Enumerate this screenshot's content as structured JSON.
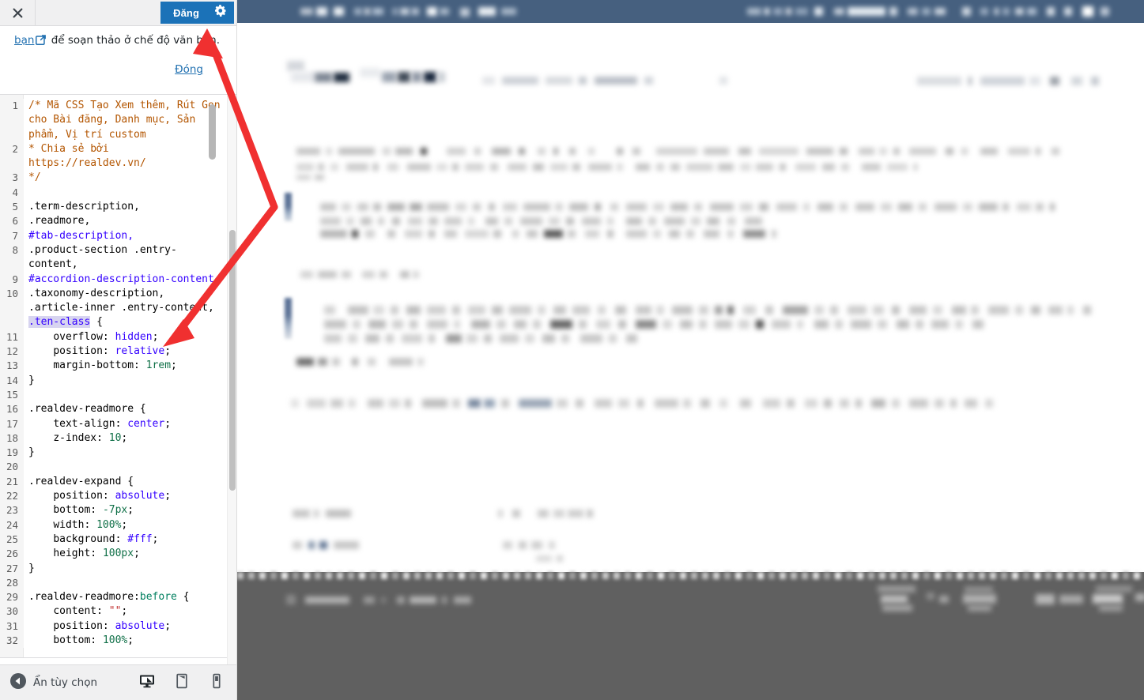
{
  "panel": {
    "header": {
      "close_icon": "close-icon",
      "publish_label": "Đăng",
      "gear_icon": "gear-icon"
    },
    "notice": {
      "link_text": "bạn",
      "external_icon": "external-link-icon",
      "text": " để soạn thảo ở chế độ văn bản.",
      "close_label": "Đóng"
    },
    "footer": {
      "collapse_icon": "collapse-arrow-icon",
      "collapse_label": "Ẩn tùy chọn",
      "devices": [
        {
          "name": "desktop-preview-icon",
          "label": "Desktop"
        },
        {
          "name": "tablet-preview-icon",
          "label": "Tablet"
        },
        {
          "name": "mobile-preview-icon",
          "label": "Mobile"
        }
      ]
    }
  },
  "editor": {
    "language": "css",
    "highlighted_token": ".ten-class",
    "lines": [
      {
        "n": "1",
        "segments": [
          {
            "t": "/* Mã CSS Tạo Xem thêm, Rút Gọn cho Bài đăng, Danh mục, Sản phẩm, Vị trí custom",
            "c": "tok-comment"
          }
        ]
      },
      {
        "n": "2",
        "segments": [
          {
            "t": "* Chia sẻ bởi https://realdev.vn/",
            "c": "tok-comment"
          }
        ]
      },
      {
        "n": "3",
        "segments": [
          {
            "t": "*/",
            "c": "tok-comment"
          }
        ]
      },
      {
        "n": "4",
        "segments": [
          {
            "t": "",
            "c": "tok-sel"
          }
        ]
      },
      {
        "n": "5",
        "segments": [
          {
            "t": ".term-description,",
            "c": "tok-sel"
          }
        ]
      },
      {
        "n": "6",
        "segments": [
          {
            "t": ".readmore,",
            "c": "tok-sel"
          }
        ]
      },
      {
        "n": "7",
        "segments": [
          {
            "t": "#tab-description,",
            "c": "tok-id"
          }
        ]
      },
      {
        "n": "8",
        "segments": [
          {
            "t": ".product-section .entry-content,",
            "c": "tok-sel"
          }
        ]
      },
      {
        "n": "9",
        "segments": [
          {
            "t": "#accordion-description-content,",
            "c": "tok-id"
          }
        ]
      },
      {
        "n": "10",
        "segments": [
          {
            "t": ".taxonomy-description, .article-inner .entry-content, ",
            "c": "tok-sel"
          },
          {
            "t": ".ten-class",
            "c": "hl-class"
          },
          {
            "t": " {",
            "c": "tok-punct"
          }
        ]
      },
      {
        "n": "11",
        "segments": [
          {
            "t": "    overflow: ",
            "c": "tok-prop"
          },
          {
            "t": "hidden",
            "c": "tok-val"
          },
          {
            "t": ";",
            "c": "tok-punct"
          }
        ]
      },
      {
        "n": "12",
        "segments": [
          {
            "t": "    position: ",
            "c": "tok-prop"
          },
          {
            "t": "relative",
            "c": "tok-val"
          },
          {
            "t": ";",
            "c": "tok-punct"
          }
        ]
      },
      {
        "n": "13",
        "segments": [
          {
            "t": "    margin-bottom: ",
            "c": "tok-prop"
          },
          {
            "t": "1rem",
            "c": "tok-num"
          },
          {
            "t": ";",
            "c": "tok-punct"
          }
        ]
      },
      {
        "n": "14",
        "segments": [
          {
            "t": "}",
            "c": "tok-punct"
          }
        ]
      },
      {
        "n": "15",
        "segments": [
          {
            "t": "",
            "c": "tok-sel"
          }
        ]
      },
      {
        "n": "16",
        "segments": [
          {
            "t": ".realdev-readmore {",
            "c": "tok-sel"
          }
        ]
      },
      {
        "n": "17",
        "segments": [
          {
            "t": "    text-align: ",
            "c": "tok-prop"
          },
          {
            "t": "center",
            "c": "tok-val"
          },
          {
            "t": ";",
            "c": "tok-punct"
          }
        ]
      },
      {
        "n": "18",
        "segments": [
          {
            "t": "    z-index: ",
            "c": "tok-prop"
          },
          {
            "t": "10",
            "c": "tok-num"
          },
          {
            "t": ";",
            "c": "tok-punct"
          }
        ]
      },
      {
        "n": "19",
        "segments": [
          {
            "t": "}",
            "c": "tok-punct"
          }
        ]
      },
      {
        "n": "20",
        "segments": [
          {
            "t": "",
            "c": "tok-sel"
          }
        ]
      },
      {
        "n": "21",
        "segments": [
          {
            "t": ".realdev-expand {",
            "c": "tok-sel"
          }
        ]
      },
      {
        "n": "22",
        "segments": [
          {
            "t": "    position: ",
            "c": "tok-prop"
          },
          {
            "t": "absolute",
            "c": "tok-val"
          },
          {
            "t": ";",
            "c": "tok-punct"
          }
        ]
      },
      {
        "n": "23",
        "segments": [
          {
            "t": "    bottom: ",
            "c": "tok-prop"
          },
          {
            "t": "-7px",
            "c": "tok-num"
          },
          {
            "t": ";",
            "c": "tok-punct"
          }
        ]
      },
      {
        "n": "24",
        "segments": [
          {
            "t": "    width: ",
            "c": "tok-prop"
          },
          {
            "t": "100%",
            "c": "tok-num"
          },
          {
            "t": ";",
            "c": "tok-punct"
          }
        ]
      },
      {
        "n": "25",
        "segments": [
          {
            "t": "    background: ",
            "c": "tok-prop"
          },
          {
            "t": "#fff",
            "c": "tok-val"
          },
          {
            "t": ";",
            "c": "tok-punct"
          }
        ]
      },
      {
        "n": "26",
        "segments": [
          {
            "t": "    height: ",
            "c": "tok-prop"
          },
          {
            "t": "100px",
            "c": "tok-num"
          },
          {
            "t": ";",
            "c": "tok-punct"
          }
        ]
      },
      {
        "n": "27",
        "segments": [
          {
            "t": "}",
            "c": "tok-punct"
          }
        ]
      },
      {
        "n": "28",
        "segments": [
          {
            "t": "",
            "c": "tok-sel"
          }
        ]
      },
      {
        "n": "29",
        "segments": [
          {
            "t": ".realdev-readmore:",
            "c": "tok-sel"
          },
          {
            "t": "before",
            "c": "tok-pseudo"
          },
          {
            "t": " {",
            "c": "tok-punct"
          }
        ]
      },
      {
        "n": "30",
        "segments": [
          {
            "t": "    content: ",
            "c": "tok-prop"
          },
          {
            "t": "\"\"",
            "c": "tok-str"
          },
          {
            "t": ";",
            "c": "tok-punct"
          }
        ]
      },
      {
        "n": "31",
        "segments": [
          {
            "t": "    position: ",
            "c": "tok-prop"
          },
          {
            "t": "absolute",
            "c": "tok-val"
          },
          {
            "t": ";",
            "c": "tok-punct"
          }
        ]
      },
      {
        "n": "32",
        "segments": [
          {
            "t": "    bottom: ",
            "c": "tok-prop"
          },
          {
            "t": "100%",
            "c": "tok-num"
          },
          {
            "t": ";",
            "c": "tok-punct"
          }
        ]
      }
    ]
  },
  "preview": {
    "admin_bar_color": "#46607f",
    "footer_color": "#606060",
    "accent_color": "#5a7196",
    "content_obscured": true
  },
  "annotations": {
    "arrow_color": "#f03030",
    "arrows": [
      {
        "name": "arrow-to-publish-button",
        "points_to": "Đăng"
      },
      {
        "name": "arrow-to-ten-class",
        "points_to": ".ten-class"
      }
    ]
  },
  "theme": {
    "publish_button_color": "#1b72b8",
    "link_color": "#2271b1",
    "panel_bg": "#f0f0f1",
    "highlight_color": "#d7d4f0"
  }
}
